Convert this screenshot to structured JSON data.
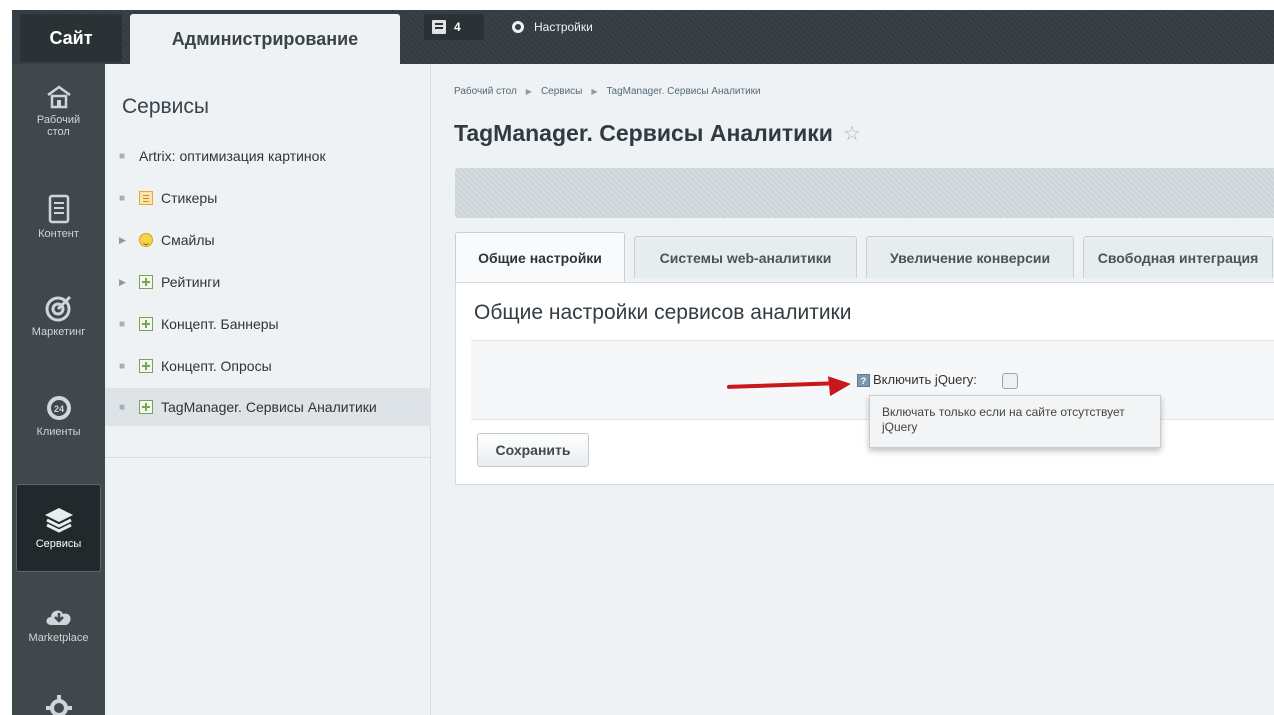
{
  "topbar": {
    "site_tab": "Сайт",
    "admin_tab": "Администрирование",
    "notifications_count": "4",
    "settings_label": "Настройки"
  },
  "leftmenu": {
    "items": [
      {
        "label": "Рабочий стол",
        "icon": "home-icon"
      },
      {
        "label": "Контент",
        "icon": "document-icon"
      },
      {
        "label": "Маркетинг",
        "icon": "target-icon"
      },
      {
        "label": "Клиенты",
        "icon": "clock-24-icon"
      },
      {
        "label": "Сервисы",
        "icon": "layers-icon"
      },
      {
        "label": "Marketplace",
        "icon": "cloud-download-icon"
      },
      {
        "label": "",
        "icon": "gear-icon"
      }
    ]
  },
  "sidebar": {
    "title": "Сервисы",
    "items": [
      {
        "label": "Artrix: оптимизация картинок"
      },
      {
        "label": "Стикеры"
      },
      {
        "label": "Смайлы"
      },
      {
        "label": "Рейтинги"
      },
      {
        "label": "Концепт. Баннеры"
      },
      {
        "label": "Концепт. Опросы"
      },
      {
        "label": "TagManager. Сервисы Аналитики"
      }
    ]
  },
  "breadcrumb": [
    "Рабочий стол",
    "Сервисы",
    "TagManager. Сервисы Аналитики"
  ],
  "page": {
    "title": "TagManager. Сервисы Аналитики",
    "tabs": [
      {
        "label": "Общие настройки"
      },
      {
        "label": "Системы web-аналитики"
      },
      {
        "label": "Увеличение конверсии"
      },
      {
        "label": "Свободная интеграция"
      }
    ],
    "section_title": "Общие настройки сервисов аналитики",
    "field_label": "Включить jQuery:",
    "tooltip_text": "Включать только если на сайте отсутствует jQuery",
    "save_button": "Сохранить"
  },
  "colors": {
    "menu_bg": "#40484c",
    "sidebar_bg": "#eef2f4",
    "annotation_arrow": "#c8181c"
  }
}
